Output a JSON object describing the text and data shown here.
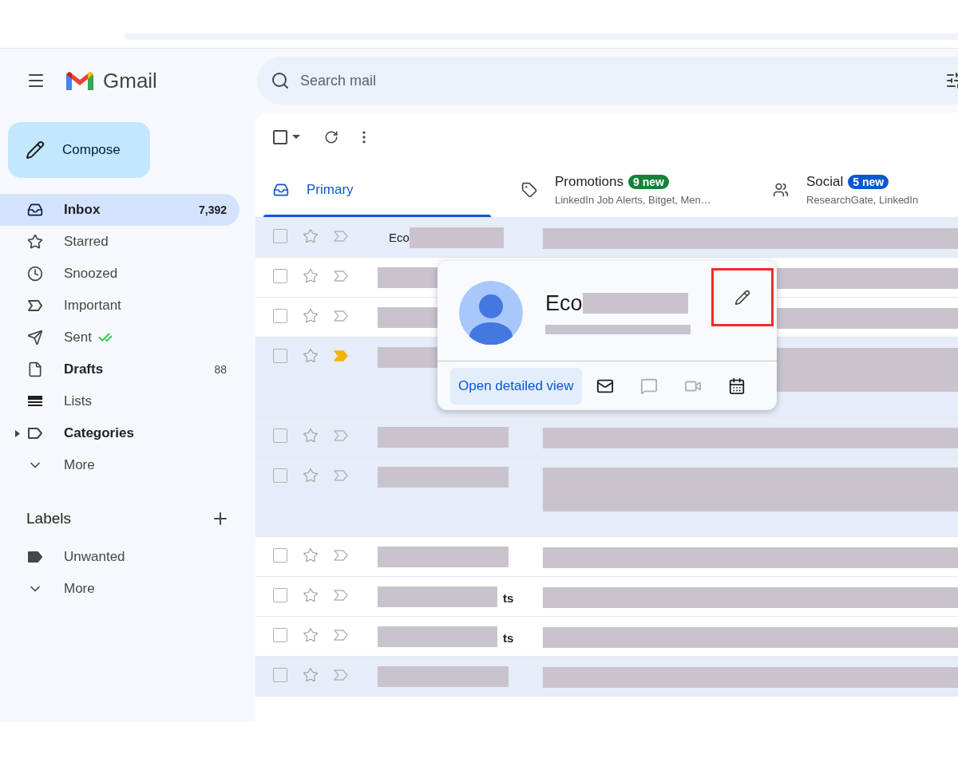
{
  "app": {
    "name": "Gmail"
  },
  "compose": {
    "label": "Compose"
  },
  "search": {
    "placeholder": "Search mail"
  },
  "toolbar": {
    "select_all_checked": false
  },
  "nav": [
    {
      "label": "Inbox",
      "count": "7,392",
      "selected": true,
      "unread": true,
      "kind": "inbox"
    },
    {
      "label": "Starred",
      "selected": false,
      "unread": false,
      "kind": "star"
    },
    {
      "label": "Snoozed",
      "selected": false,
      "unread": false,
      "kind": "clock"
    },
    {
      "label": "Important",
      "selected": false,
      "unread": false,
      "kind": "important"
    },
    {
      "label": "Sent",
      "selected": false,
      "unread": false,
      "kind": "sent"
    },
    {
      "label": "Drafts",
      "count": "88",
      "selected": false,
      "unread": true,
      "kind": "draft"
    },
    {
      "label": "Lists",
      "selected": false,
      "unread": false,
      "kind": "lists"
    },
    {
      "label": "Categories",
      "selected": false,
      "unread": true,
      "kind": "group"
    },
    {
      "label": "More",
      "selected": false,
      "unread": false,
      "kind": "more"
    }
  ],
  "labels": {
    "title": "Labels",
    "items": [
      {
        "label": "Unwanted",
        "kind": "label"
      },
      {
        "label": "More",
        "kind": "more"
      }
    ]
  },
  "tabs": [
    {
      "label": "Primary",
      "selected": true,
      "kind": "inbox"
    },
    {
      "label": "Promotions",
      "selected": false,
      "kind": "tag",
      "badge": "9 new",
      "color": "#188038",
      "subtitle": "LinkedIn Job Alerts, Bitget, Men…"
    },
    {
      "label": "Social",
      "selected": false,
      "kind": "people",
      "badge": "5 new",
      "color": "#0b57d0",
      "subtitle": "ResearchGate, LinkedIn"
    }
  ],
  "emails": [
    {
      "sender": "Eco",
      "kind": "text_first",
      "checked": false,
      "read": true,
      "important": false,
      "attachment": false
    },
    {
      "kind": "redacted",
      "checked": false,
      "read": false,
      "important": false,
      "attachment": false
    },
    {
      "kind": "redacted",
      "checked": false,
      "read": false,
      "important": false,
      "attachment": false
    },
    {
      "kind": "redacted",
      "checked": false,
      "read": true,
      "important": true,
      "attachment": true
    },
    {
      "kind": "redacted",
      "checked": false,
      "read": true,
      "important": false,
      "attachment": false
    },
    {
      "kind": "redacted",
      "checked": false,
      "read": true,
      "important": false,
      "attachment": true
    },
    {
      "kind": "redacted",
      "checked": false,
      "read": false,
      "important": false,
      "attachment": false
    },
    {
      "sender": "ts",
      "kind": "redacted_first",
      "checked": false,
      "read": false,
      "important": false,
      "attachment": false
    },
    {
      "sender": "ts",
      "kind": "redacted_first",
      "checked": false,
      "read": false,
      "important": false,
      "attachment": false
    },
    {
      "kind": "redacted",
      "checked": false,
      "read": true,
      "important": false,
      "attachment": false
    }
  ],
  "contact_card": {
    "name": "Eco",
    "button": "Open detailed view",
    "edit_highlighted": true,
    "actions": [
      {
        "kind": "mail",
        "disabled": false
      },
      {
        "kind": "chat",
        "disabled": true
      },
      {
        "kind": "video",
        "disabled": true
      },
      {
        "kind": "calendar",
        "disabled": false
      }
    ]
  }
}
